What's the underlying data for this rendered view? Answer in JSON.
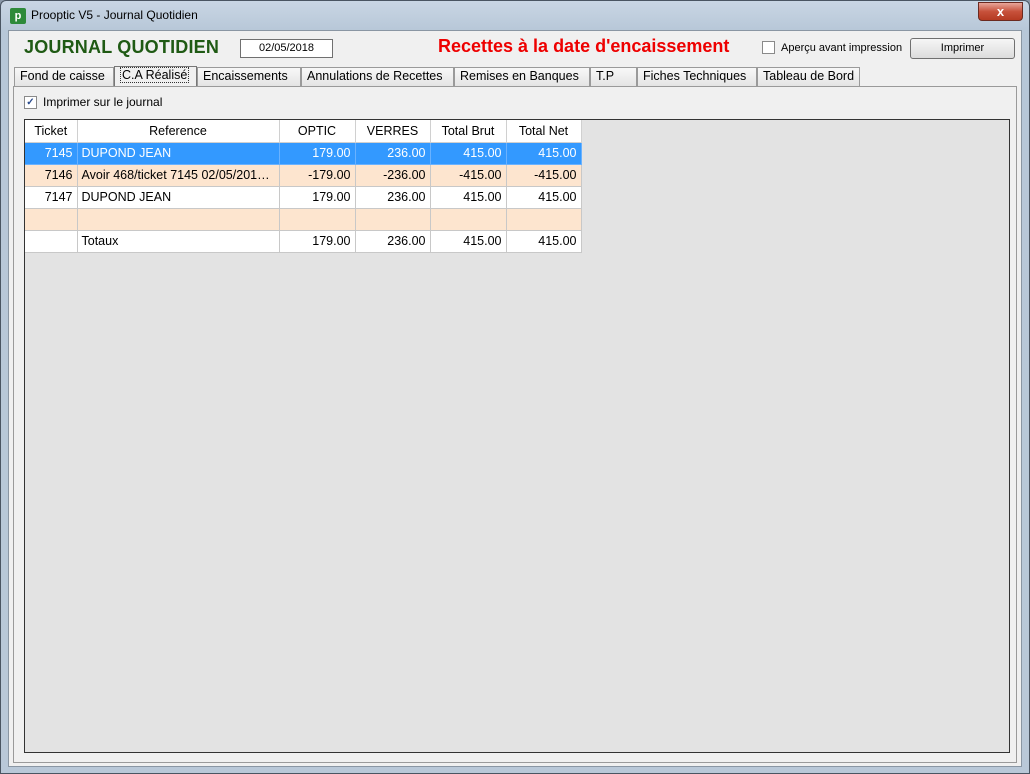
{
  "window": {
    "title": "Prooptic V5 - Journal Quotidien",
    "close_label": "x"
  },
  "header": {
    "title": "JOURNAL QUOTIDIEN",
    "date": "02/05/2018",
    "subtitle": "Recettes à la date d'encaissement",
    "apercu_label": "Aperçu avant impression",
    "print_button": "Imprimer"
  },
  "tabs": [
    {
      "label": "Fond de caisse"
    },
    {
      "label": "C.A Réalisé"
    },
    {
      "label": "Encaissements"
    },
    {
      "label": "Annulations de Recettes"
    },
    {
      "label": "Remises en Banques"
    },
    {
      "label": "T.P"
    },
    {
      "label": "Fiches Techniques"
    },
    {
      "label": "Tableau de Bord"
    }
  ],
  "panel": {
    "print_journal_label": "Imprimer sur le journal",
    "print_journal_checked": "✓"
  },
  "table": {
    "columns": [
      "Ticket",
      "Reference",
      "OPTIC",
      "VERRES",
      "Total Brut",
      "Total Net"
    ],
    "rows": [
      {
        "ticket": "7145",
        "reference": "DUPOND JEAN",
        "optic": "179.00",
        "verres": "236.00",
        "brut": "415.00",
        "net": "415.00"
      },
      {
        "ticket": "7146",
        "reference": "Avoir 468/ticket 7145 02/05/201…",
        "optic": "-179.00",
        "verres": "-236.00",
        "brut": "-415.00",
        "net": "-415.00"
      },
      {
        "ticket": "7147",
        "reference": "DUPOND JEAN",
        "optic": "179.00",
        "verres": "236.00",
        "brut": "415.00",
        "net": "415.00"
      },
      {
        "ticket": "",
        "reference": "",
        "optic": "",
        "verres": "",
        "brut": "",
        "net": ""
      }
    ],
    "totals": {
      "ticket": "",
      "reference": "Totaux",
      "optic": "179.00",
      "verres": "236.00",
      "brut": "415.00",
      "net": "415.00"
    }
  },
  "colors": {
    "title_green": "#1f5a14",
    "subtitle_red": "#ee0000",
    "selection_blue": "#3399ff",
    "row_peach": "#fde5cf"
  }
}
